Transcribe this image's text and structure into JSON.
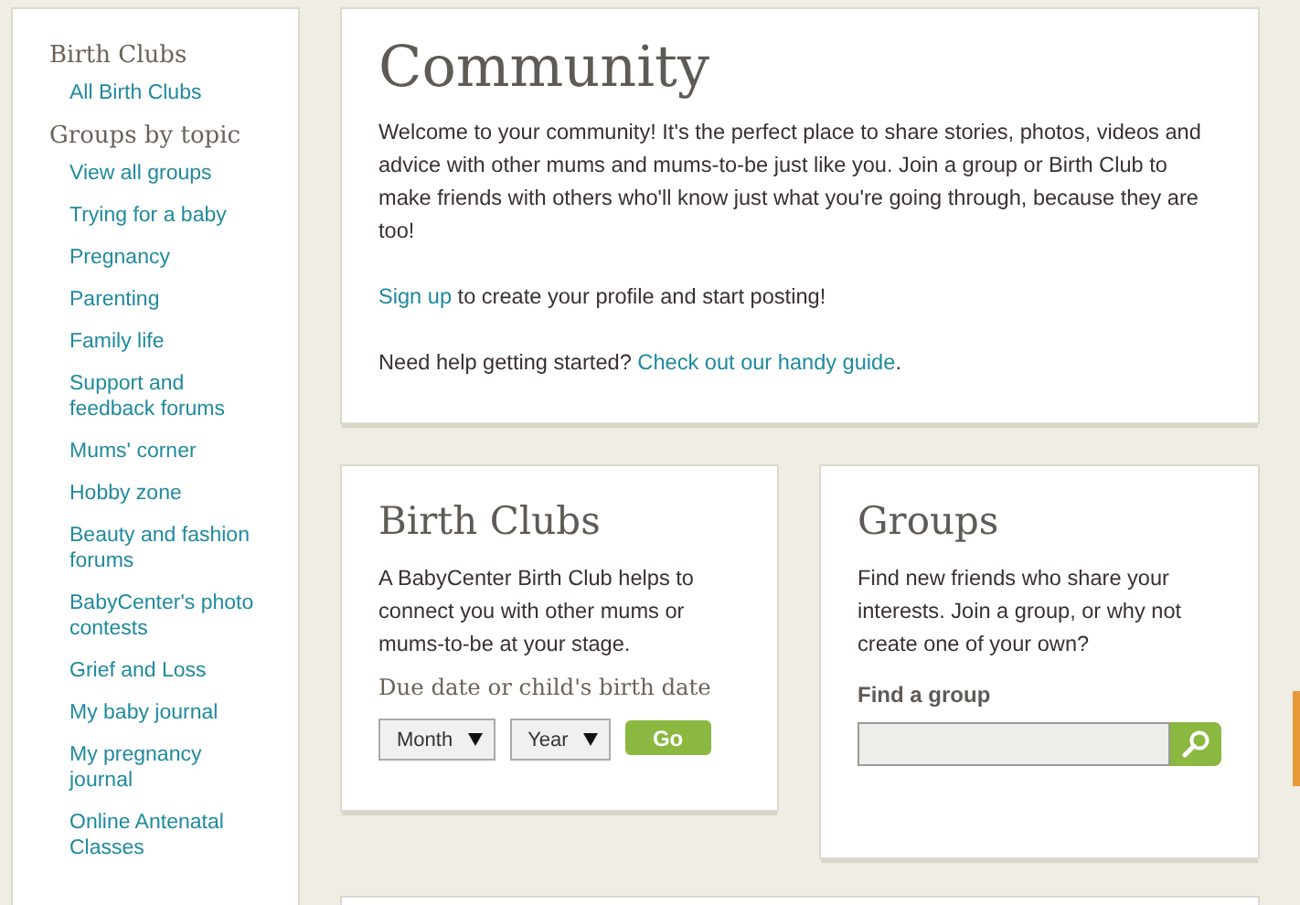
{
  "sidebar": {
    "sections": [
      {
        "heading": "Birth Clubs",
        "items": [
          "All Birth Clubs"
        ]
      },
      {
        "heading": "Groups by topic",
        "items": [
          "View all groups",
          "Trying for a baby",
          "Pregnancy",
          "Parenting",
          "Family life",
          "Support and feedback forums",
          "Mums' corner",
          "Hobby zone",
          "Beauty and fashion forums",
          "BabyCenter's photo contests",
          "Grief and Loss",
          "My baby journal",
          "My pregnancy journal",
          "Online Antenatal Classes"
        ]
      }
    ]
  },
  "intro": {
    "title": "Community",
    "paragraphs": [
      [
        {
          "text": "Welcome to your community! It's the perfect place to share stories, photos, videos and advice with other mums and mums-to-be just like you. Join a group or Birth Club to make friends with others who'll know just what you're going through, because they are too!",
          "link": false
        }
      ],
      [
        {
          "text": "Sign up",
          "link": true
        },
        {
          "text": " to create your profile and start posting!",
          "link": false
        }
      ],
      [
        {
          "text": "Need help getting started? ",
          "link": false
        },
        {
          "text": "Check out our handy guide",
          "link": true
        },
        {
          "text": ".",
          "link": false
        }
      ]
    ]
  },
  "birth_clubs": {
    "title": "Birth Clubs",
    "description": "A BabyCenter Birth Club helps to connect you with other mums or mums-to-be at your stage.",
    "date_label": "Due date or child's birth date",
    "selects": [
      "Month",
      "Year"
    ],
    "button": "Go"
  },
  "groups": {
    "title": "Groups",
    "description": "Find new friends who share your interests. Join a group, or why not create one of your own?",
    "search_label": "Find a group"
  }
}
